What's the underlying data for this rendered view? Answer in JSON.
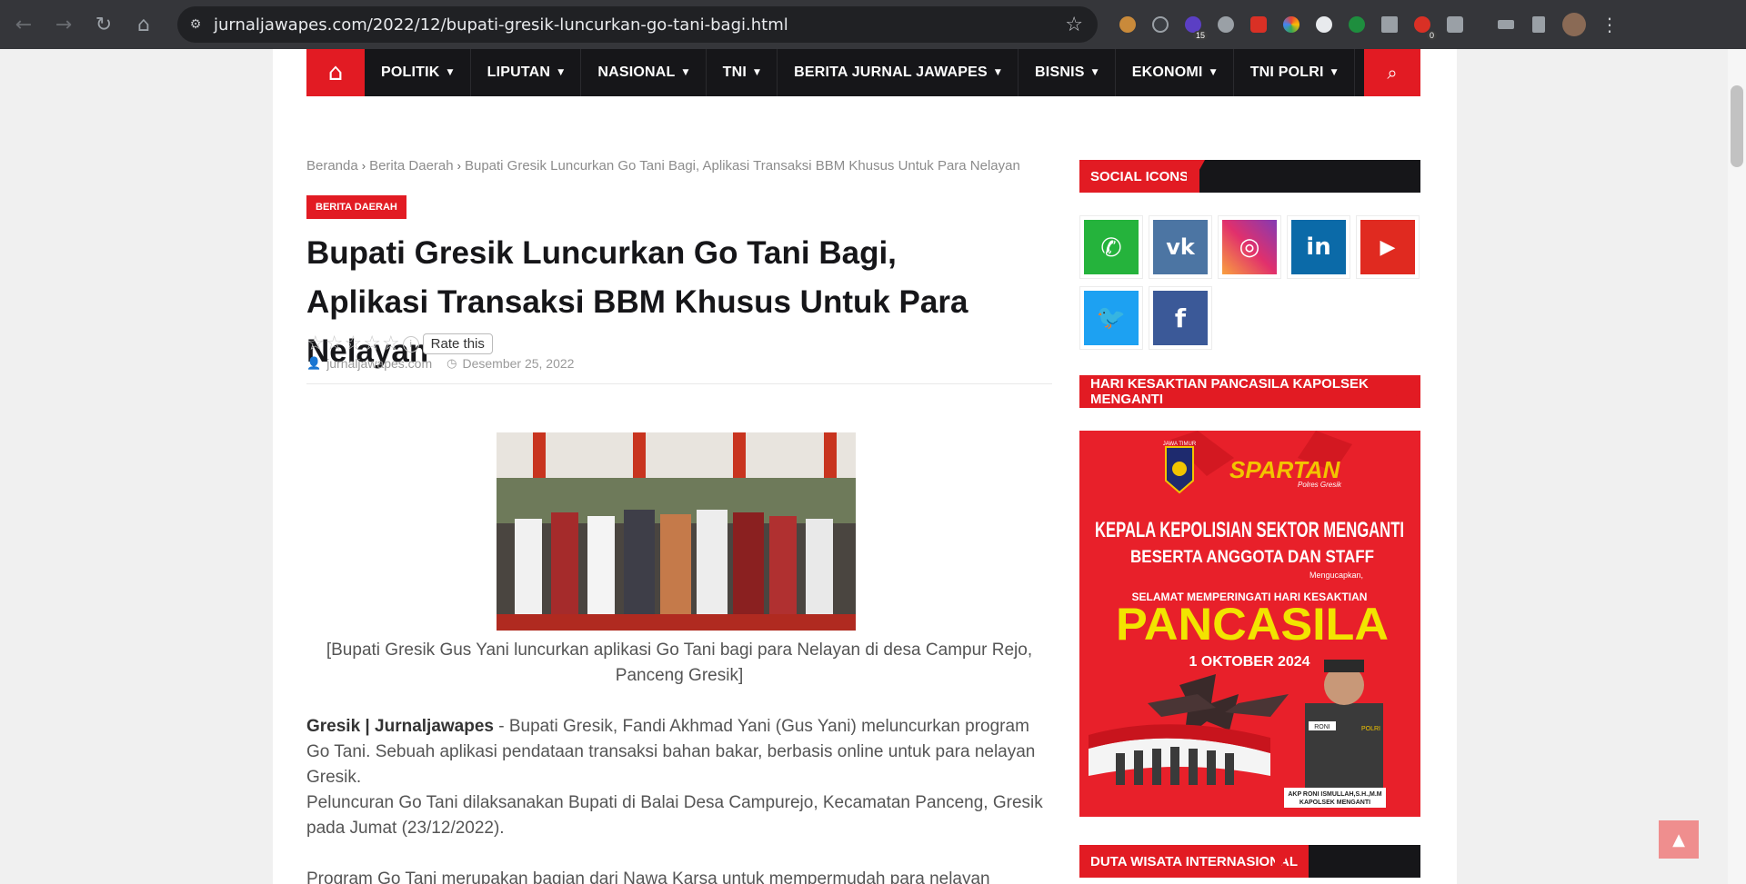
{
  "browser": {
    "url": "jurnaljawapes.com/2022/12/bupati-gresik-luncurkan-go-tani-bagi.html",
    "badge_15": "15",
    "badge_0": "0"
  },
  "menu": {
    "items": [
      {
        "label": "POLITIK"
      },
      {
        "label": "LIPUTAN"
      },
      {
        "label": "NASIONAL"
      },
      {
        "label": "TNI"
      },
      {
        "label": "BERITA JURNAL JAWAPES"
      },
      {
        "label": "BISNIS"
      },
      {
        "label": "EKONOMI"
      },
      {
        "label": "TNI POLRI"
      }
    ]
  },
  "breadcrumb": {
    "home": "Beranda",
    "category": "Berita Daerah",
    "current": "Bupati Gresik Luncurkan Go Tani Bagi, Aplikasi Transaksi BBM Khusus Untuk Para Nelayan"
  },
  "article": {
    "category_badge": "BERITA DAERAH",
    "title": "Bupati Gresik Luncurkan Go Tani Bagi, Aplikasi Transaksi BBM Khusus Untuk Para Nelayan",
    "rating": 0,
    "rate_tip": "Rate this",
    "author": "jurnaljawapes.com",
    "date": "Desember 25, 2022",
    "caption": "[Bupati Gresik Gus Yani luncurkan aplikasi Go Tani bagi para Nelayan di desa Campur Rejo, Panceng Gresik]",
    "dateline": "Gresik | Jurnaljawapes",
    "p1": " -  Bupati Gresik, Fandi Akhmad Yani (Gus Yani) meluncurkan program Go Tani. Sebuah aplikasi pendataan transaksi bahan bakar, berbasis online untuk para nelayan Gresik.",
    "p2": "Peluncuran Go Tani dilaksanakan Bupati di Balai Desa Campurejo, Kecamatan Panceng, Gresik pada Jumat (23/12/2022).",
    "p3": "Program Go Tani merupakan bagian dari Nawa Karsa untuk mempermudah para nelayan"
  },
  "sidebar": {
    "social_title": "SOCIAL ICONS",
    "banner_title": "HARI KESAKTIAN PANCASILA KAPOLSEK MENGANTI",
    "duta_title": "DUTA WISATA INTERNASIONAL",
    "social": [
      {
        "name": "whatsapp",
        "color": "#25b33c"
      },
      {
        "name": "vk",
        "color": "#4c75a3"
      },
      {
        "name": "instagram",
        "color": "#c13584"
      },
      {
        "name": "linkedin",
        "color": "#0b6aa8"
      },
      {
        "name": "youtube",
        "color": "#e02a20"
      },
      {
        "name": "twitter",
        "color": "#1da1f2"
      },
      {
        "name": "facebook",
        "color": "#3b5998"
      }
    ],
    "banner": {
      "logo_text": "JAWA TIMUR",
      "spartan": "SPARTAN",
      "spartan_sub": "Polres Gresik",
      "line1": "KEPALA KEPOLISIAN SEKTOR MENGANTI",
      "line2": "BESERTA ANGGOTA DAN STAFF",
      "line3": "Mengucapkan,",
      "line4": "SELAMAT MEMPERINGATI HARI KESAKTIAN",
      "line5": "PANCASILA",
      "line6": "1 OKTOBER 2024",
      "badge_name": "RONI",
      "badge_polri": "POLRI",
      "sign1": "AKP RONI ISMULLAH,S.H.,M.M",
      "sign2": "KAPOLSEK MENGANTI"
    }
  },
  "colors": {
    "accent": "#e21b23",
    "dark": "#161619"
  }
}
